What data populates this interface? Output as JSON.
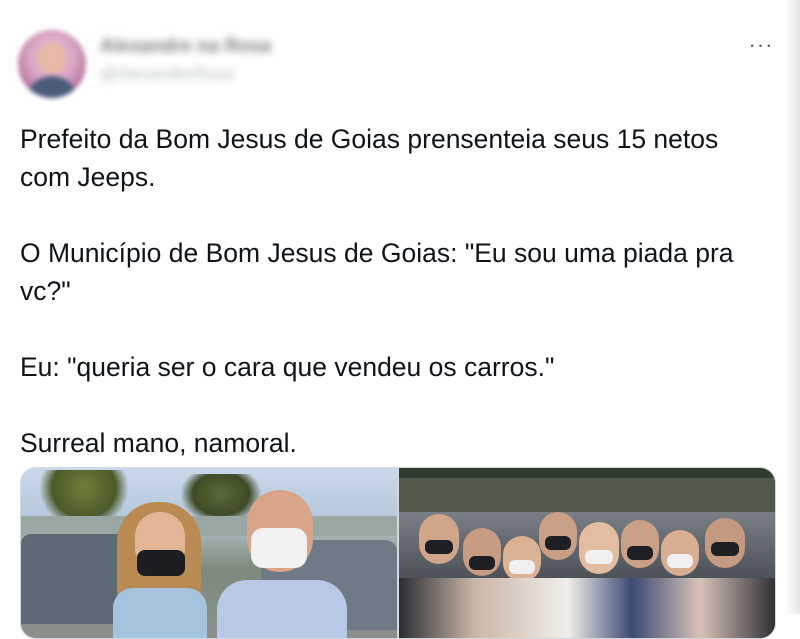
{
  "tweet": {
    "author": {
      "display_name": "Alexandre na Rosa",
      "handle": "@AlexandreRosa"
    },
    "more_icon": "more-horizontal-icon",
    "paragraphs": [
      "Prefeito da Bom Jesus de Goias prensenteia seus 15 netos com Jeeps.",
      "O Município de Bom Jesus de Goias: \"Eu sou uma piada pra vc?\"",
      "Eu: \"queria ser o cara que vendeu os carros.\"",
      "Surreal mano, namoral."
    ],
    "media": {
      "photos": [
        "photo-left",
        "photo-right"
      ]
    }
  },
  "colors": {
    "text": "#0f1419",
    "secondary": "#536471",
    "border": "#cfd9de"
  }
}
